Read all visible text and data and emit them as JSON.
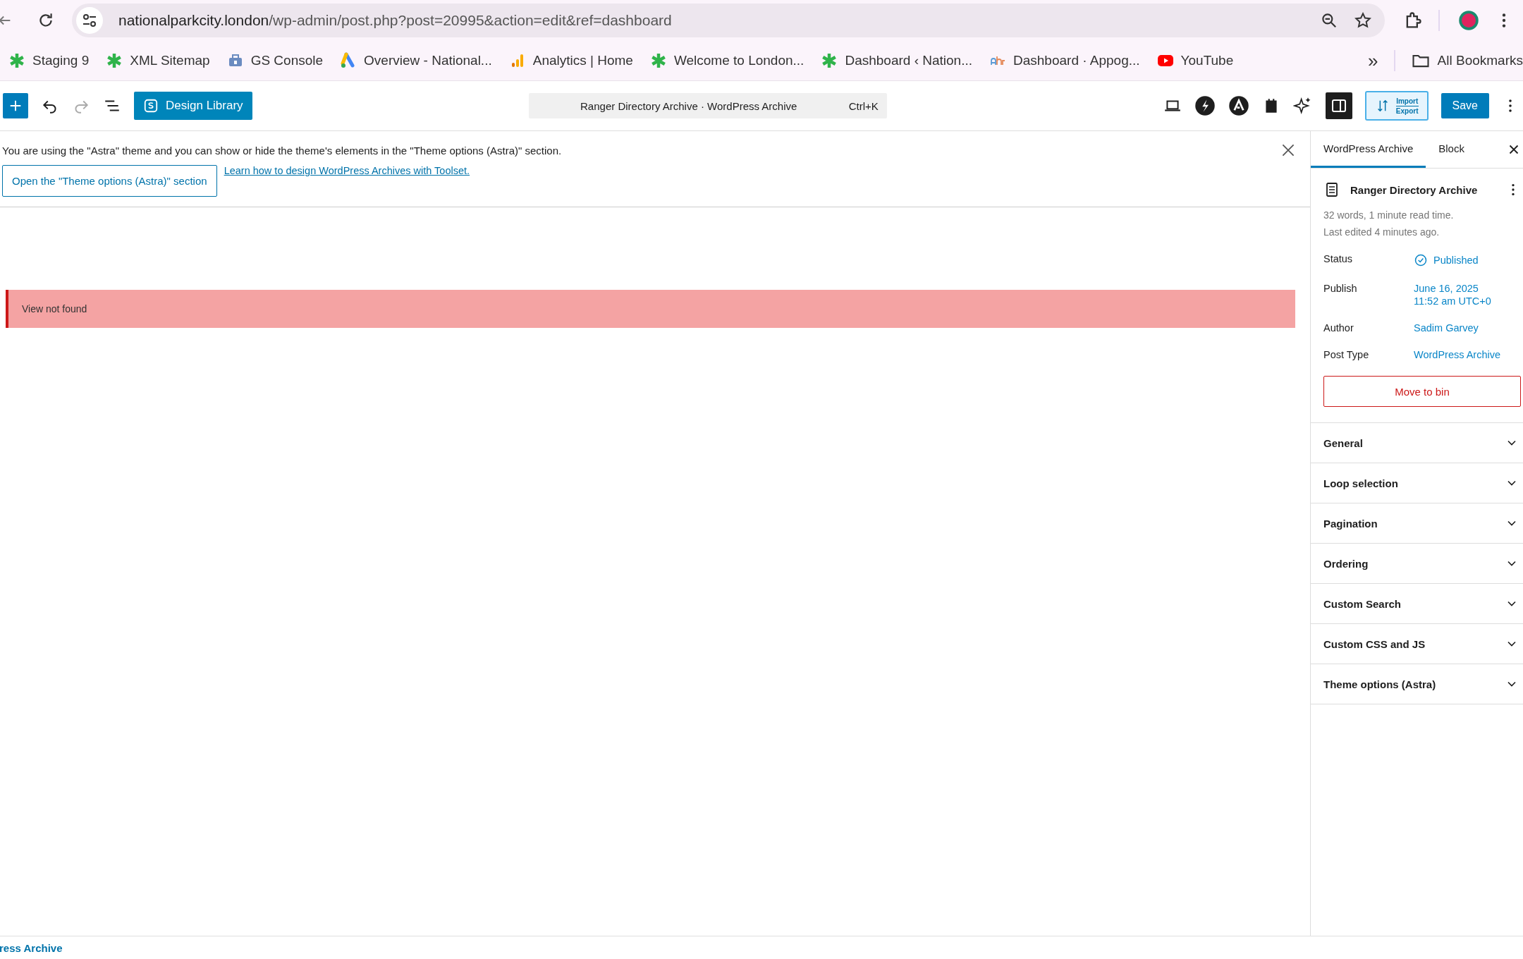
{
  "browser": {
    "url_host": "nationalparkcity.london",
    "url_path": "/wp-admin/post.php?post=20995&action=edit&ref=dashboard",
    "bookmarks": [
      {
        "kind": "star",
        "label": "Staging 9"
      },
      {
        "kind": "star",
        "label": "XML Sitemap"
      },
      {
        "kind": "console",
        "label": "GS Console"
      },
      {
        "kind": "ads",
        "label": "Overview - National..."
      },
      {
        "kind": "analytics",
        "label": "Analytics | Home"
      },
      {
        "kind": "star",
        "label": "Welcome to London..."
      },
      {
        "kind": "star",
        "label": "Dashboard ‹ Nation..."
      },
      {
        "kind": "ahr",
        "label": "Dashboard · Appog..."
      },
      {
        "kind": "youtube",
        "label": "YouTube"
      }
    ],
    "overflow": "»",
    "all_bookmarks": "All Bookmarks"
  },
  "toolbar": {
    "design_library": "Design Library",
    "command": {
      "title": "Ranger Directory Archive · WordPress Archive",
      "shortcut": "Ctrl+K"
    },
    "import_label": "Import",
    "export_label": "Export",
    "save": "Save"
  },
  "notice": {
    "text": "You are using the \"Astra\" theme and you can show or hide the theme's elements in the \"Theme options (Astra)\" section.",
    "button": "Open the \"Theme options (Astra)\" section",
    "link": "Learn how to design WordPress Archives with Toolset."
  },
  "error": "View not found",
  "sidebar": {
    "tabs": [
      {
        "label": "WordPress Archive",
        "selected": true
      },
      {
        "label": "Block",
        "selected": false
      }
    ],
    "title": "Ranger Directory Archive",
    "stats": "32 words, 1 minute read time.",
    "edited": "Last edited 4 minutes ago.",
    "fields": [
      {
        "label": "Status",
        "value": "Published",
        "kind": "status"
      },
      {
        "label": "Publish",
        "value": "June 16, 2025",
        "value2": "11:52 am UTC+0",
        "kind": "date"
      },
      {
        "label": "Author",
        "value": "Sadim Garvey",
        "kind": "link"
      },
      {
        "label": "Post Type",
        "value": "WordPress Archive",
        "kind": "link"
      }
    ],
    "bin": "Move to bin",
    "panels": [
      {
        "label": "General",
        "expanded": false
      },
      {
        "label": "Loop selection",
        "expanded": false
      },
      {
        "label": "Pagination",
        "expanded": false
      },
      {
        "label": "Ordering",
        "expanded": false
      },
      {
        "label": "Custom Search",
        "expanded": false
      },
      {
        "label": "Custom CSS and JS",
        "expanded": false
      },
      {
        "label": "Theme options (Astra)",
        "expanded": false
      }
    ]
  },
  "footer": {
    "breadcrumb": "ress Archive"
  }
}
